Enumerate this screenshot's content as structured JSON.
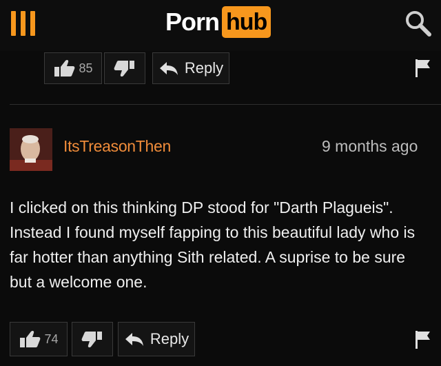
{
  "header": {
    "logo_part1": "Porn",
    "logo_part2": "hub",
    "brand_color": "#f7971d",
    "menu_icon": "hamburger-menu-icon",
    "search_icon": "search-icon"
  },
  "previous_comment": {
    "likes": "85",
    "reply_label": "Reply"
  },
  "comment": {
    "username": "ItsTreasonThen",
    "timestamp": "9 months ago",
    "body": "I clicked on this thinking DP stood for \"Darth Plagueis\". Instead I found myself fapping to this beautiful lady who is far hotter than anything Sith related. A suprise to be sure but a welcome one.",
    "likes": "74",
    "reply_label": "Reply",
    "username_color": "#f08c3a"
  }
}
